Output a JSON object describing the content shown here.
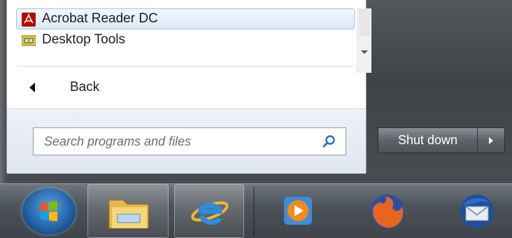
{
  "programs": {
    "items": [
      {
        "label": "Acrobat Reader DC",
        "icon": "acrobat-reader-icon",
        "selected": true
      },
      {
        "label": "Desktop Tools",
        "icon": "desktop-tools-icon",
        "selected": false
      }
    ]
  },
  "back": {
    "label": "Back"
  },
  "search": {
    "placeholder": "Search programs and files"
  },
  "shutdown": {
    "label": "Shut down"
  },
  "taskbar": {
    "items": [
      {
        "name": "start-button"
      },
      {
        "name": "file-explorer",
        "icon": "folder-icon"
      },
      {
        "name": "internet-explorer",
        "icon": "internet-explorer-icon"
      },
      {
        "name": "windows-media-player",
        "icon": "media-player-icon"
      },
      {
        "name": "firefox",
        "icon": "firefox-icon"
      },
      {
        "name": "thunderbird",
        "icon": "thunderbird-icon"
      }
    ]
  },
  "colors": {
    "selection_bg": "#dbe9f8",
    "selection_border": "#9fc3ea",
    "acrobat_red": "#b30b00"
  }
}
